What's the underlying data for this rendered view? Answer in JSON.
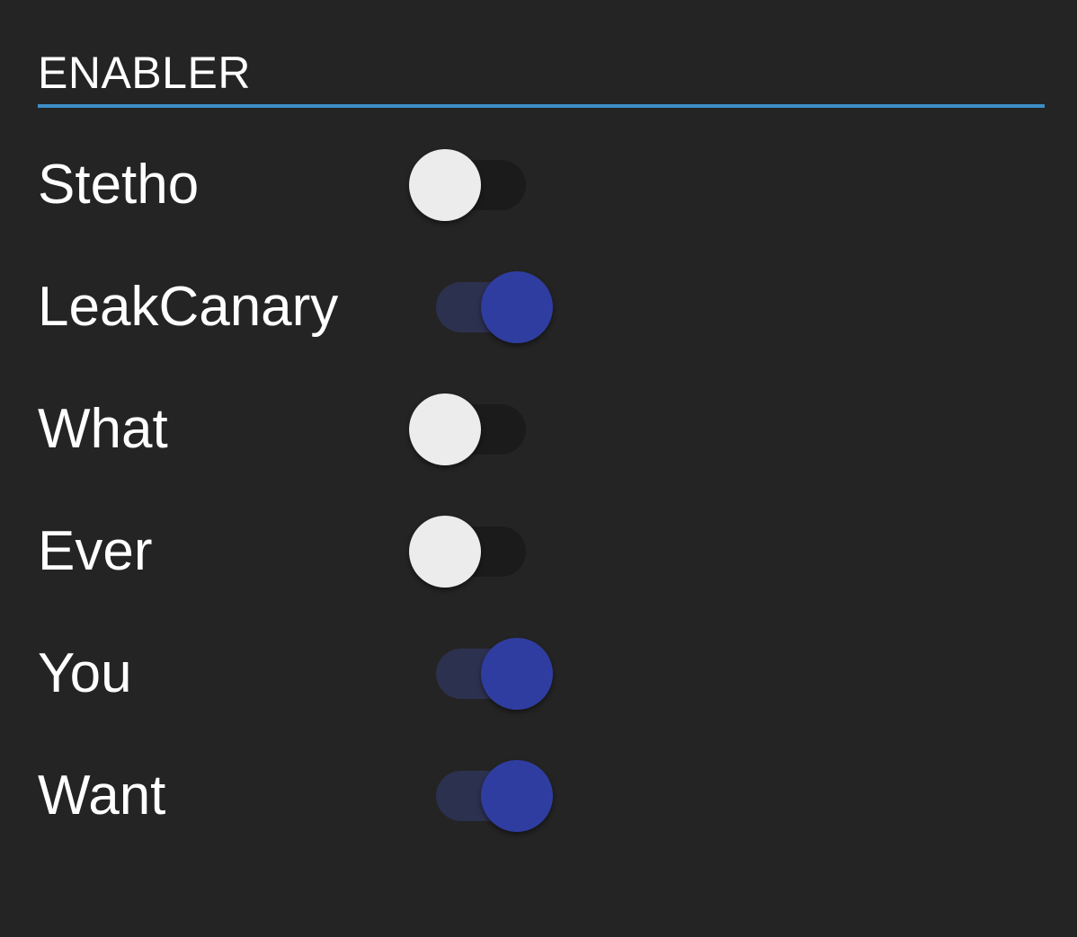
{
  "section": {
    "title": "ENABLER",
    "divider_color": "#3d8ec8"
  },
  "toggles": [
    {
      "label": "Stetho",
      "checked": false
    },
    {
      "label": "LeakCanary",
      "checked": true
    },
    {
      "label": "What",
      "checked": false
    },
    {
      "label": "Ever",
      "checked": false
    },
    {
      "label": "You",
      "checked": true
    },
    {
      "label": "Want",
      "checked": true
    }
  ],
  "colors": {
    "background": "#242424",
    "switch_on_thumb": "#303da0",
    "switch_on_track": "#2d3150",
    "switch_off_thumb": "#ececec",
    "switch_off_track": "#1b1b1b"
  }
}
